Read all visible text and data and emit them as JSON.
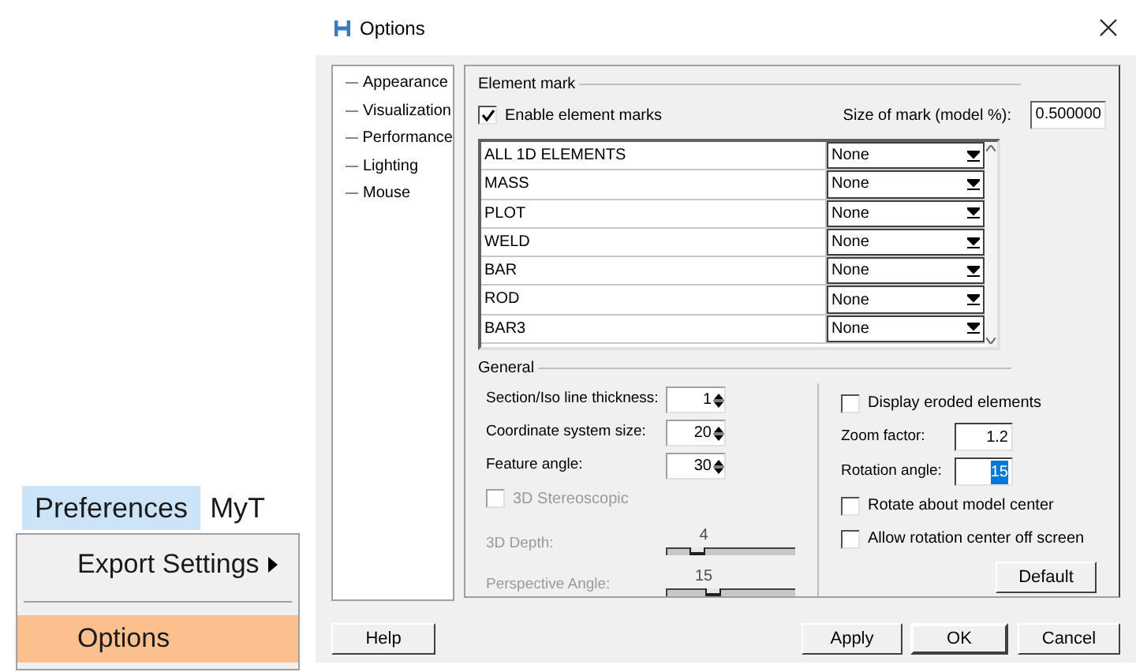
{
  "menu": {
    "title": "Preferences",
    "next_menu": "MyT",
    "items": [
      {
        "label": "Export Settings",
        "submenu": true,
        "selected": false
      },
      {
        "label": "Options",
        "submenu": false,
        "selected": true
      }
    ]
  },
  "window": {
    "title": "Options"
  },
  "tree": [
    {
      "label": "Appearance"
    },
    {
      "label": "Visualization"
    },
    {
      "label": "Performance"
    },
    {
      "label": "Lighting"
    },
    {
      "label": "Mouse"
    }
  ],
  "element_mark": {
    "title": "Element mark",
    "enable": {
      "label": "Enable element marks",
      "checked": true
    },
    "size_label": "Size of mark (model %):",
    "size_value": "0.500000",
    "rows": [
      {
        "name": "ALL 1D ELEMENTS",
        "mark": "None"
      },
      {
        "name": "MASS",
        "mark": "None"
      },
      {
        "name": "PLOT",
        "mark": "None"
      },
      {
        "name": "WELD",
        "mark": "None"
      },
      {
        "name": "BAR",
        "mark": "None"
      },
      {
        "name": "ROD",
        "mark": "None"
      },
      {
        "name": "BAR3",
        "mark": "None"
      }
    ]
  },
  "general": {
    "title": "General",
    "spinners": [
      {
        "label": "Section/Iso line thickness:",
        "value": "1"
      },
      {
        "label": "Coordinate system size:",
        "value": "20"
      },
      {
        "label": "Feature angle:",
        "value": "30"
      }
    ],
    "stereo": {
      "label": "3D Stereoscopic",
      "checked": false,
      "disabled": true
    },
    "sliders": [
      {
        "label": "3D Depth:",
        "reading": "4",
        "level": 0.2,
        "disabled": true
      },
      {
        "label": "Perspective Angle:",
        "reading": "15",
        "level": 0.33,
        "disabled": true
      }
    ],
    "right": [
      {
        "kind": "check",
        "label": "Display eroded elements",
        "checked": false
      },
      {
        "kind": "field",
        "label": "Zoom factor:",
        "value": "1.2",
        "text_selected": false
      },
      {
        "kind": "field",
        "label": "Rotation angle:",
        "value": "15",
        "text_selected": true
      },
      {
        "kind": "check",
        "label": "Rotate about model center",
        "checked": false
      },
      {
        "kind": "check",
        "label": "Allow rotation center off screen",
        "checked": false
      }
    ],
    "default_button": "Default"
  },
  "buttons": {
    "help": "Help",
    "apply": "Apply",
    "ok": "OK",
    "cancel": "Cancel"
  }
}
